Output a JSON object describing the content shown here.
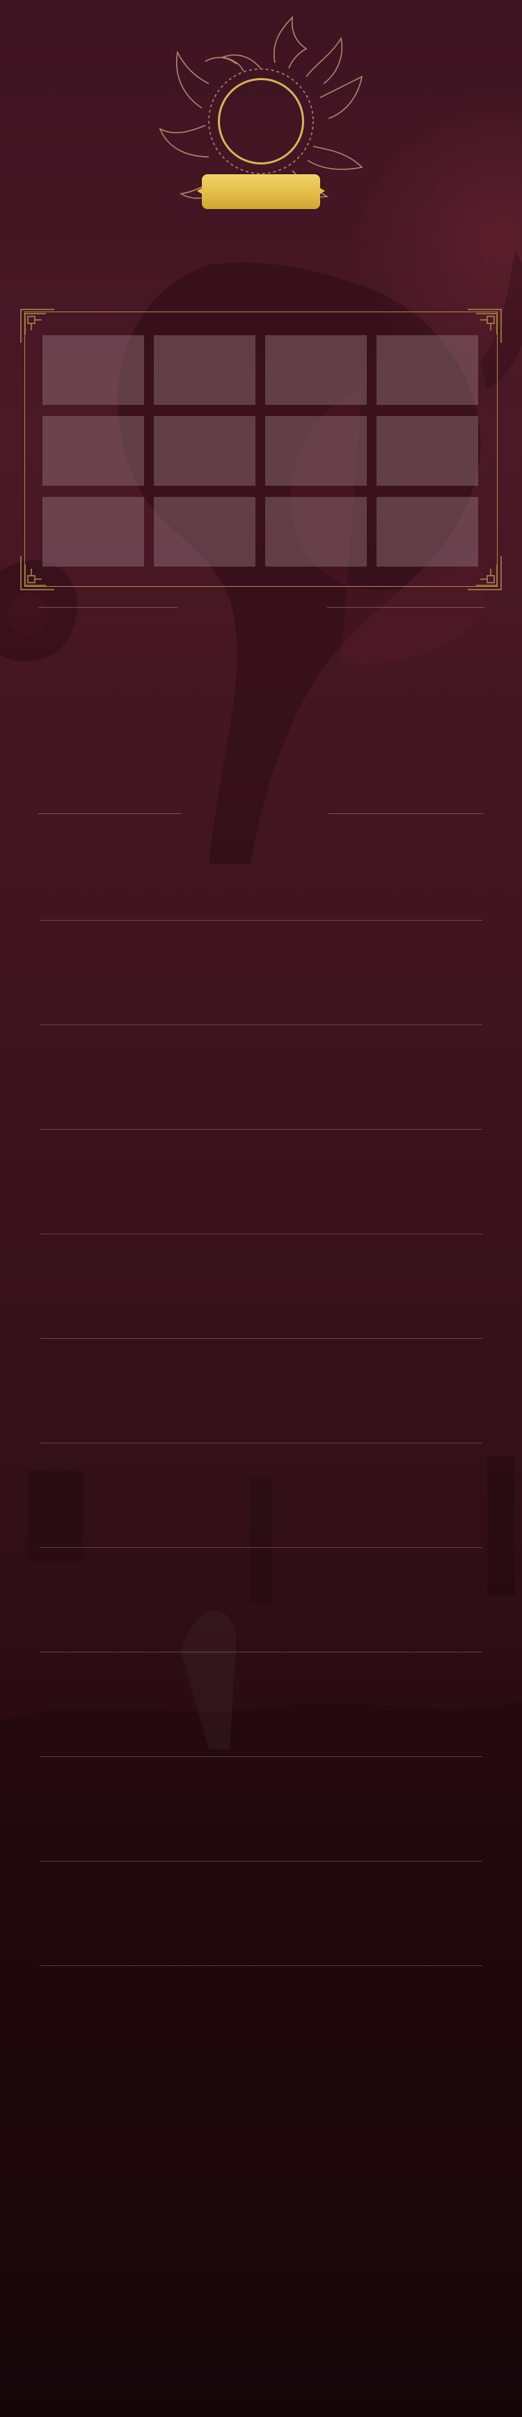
{
  "profile": {
    "nickname": "",
    "avatar_icon": "avatar-placeholder",
    "frame_icon": "flame-wreath-icon"
  },
  "gallery": {
    "tiles": [
      "",
      "",
      "",
      "",
      "",
      "",
      "",
      "",
      "",
      "",
      "",
      ""
    ]
  },
  "sections": [
    {
      "title": "",
      "body": ""
    },
    {
      "title": "",
      "body": ""
    },
    {
      "title": "",
      "body": ""
    },
    {
      "title": "",
      "body": ""
    },
    {
      "title": "",
      "body": ""
    },
    {
      "title": "",
      "body": ""
    },
    {
      "title": "",
      "body": ""
    },
    {
      "title": "",
      "body": ""
    },
    {
      "title": "",
      "body": ""
    },
    {
      "title": "",
      "body": ""
    },
    {
      "title": "",
      "body": ""
    }
  ],
  "theme": {
    "accent_gold": "#d9b35a",
    "frame_gold": "#b08a47",
    "background_top": "#4a1826",
    "background_bottom": "#150509",
    "tile_color": "#a0828c"
  }
}
